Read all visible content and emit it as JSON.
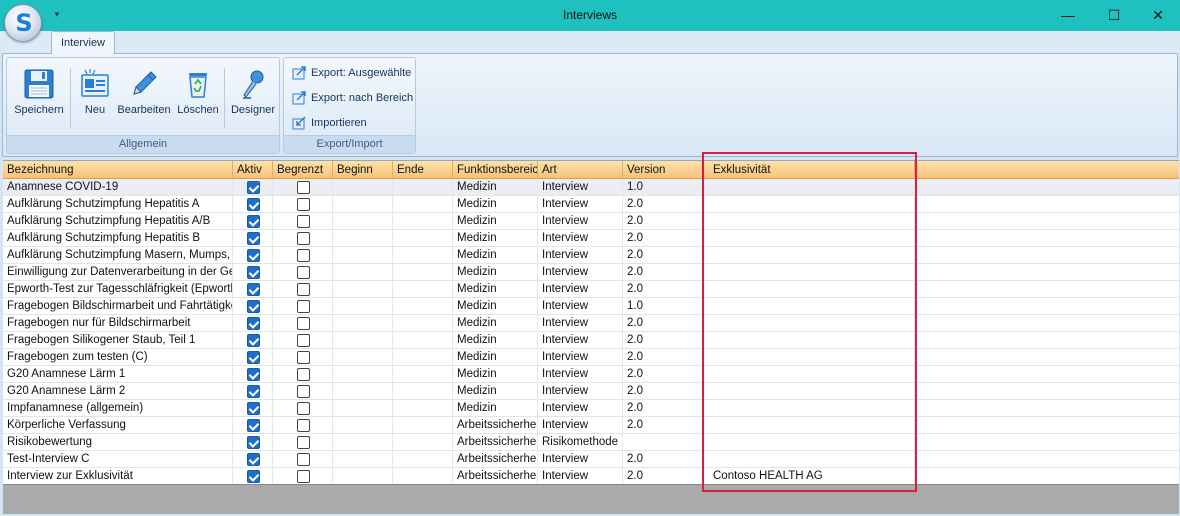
{
  "window": {
    "title": "Interviews",
    "minimize_glyph": "—",
    "maximize_glyph": "☐",
    "close_glyph": "✕",
    "qat_glyph": "▾",
    "app_letter": "S"
  },
  "ribbon": {
    "tab": "Interview",
    "groups": {
      "allgemein": {
        "caption": "Allgemein",
        "buttons": {
          "speichern": "Speichern",
          "neu": "Neu",
          "bearbeiten": "Bearbeiten",
          "loeschen": "Löschen",
          "designer": "Designer"
        }
      },
      "export": {
        "caption": "Export/Import",
        "buttons": {
          "ausgewaehlte": "Export: Ausgewählte",
          "bereich": "Export: nach Bereich",
          "importieren": "Importieren"
        }
      }
    }
  },
  "grid": {
    "columns": [
      "Bezeichnung",
      "Aktiv",
      "Begrenzt",
      "Beginn",
      "Ende",
      "Funktionsbereich",
      "Art",
      "Version",
      "Exklusivität"
    ],
    "rows": [
      {
        "bezeichnung": "Anamnese COVID-19",
        "aktiv": true,
        "begrenzt": false,
        "beginn": "",
        "ende": "",
        "funktionsbereich": "Medizin",
        "art": "Interview",
        "version": "1.0",
        "exklusivitaet": ""
      },
      {
        "bezeichnung": "Aufklärung Schutzimpfung Hepatitis A",
        "aktiv": true,
        "begrenzt": false,
        "beginn": "",
        "ende": "",
        "funktionsbereich": "Medizin",
        "art": "Interview",
        "version": "2.0",
        "exklusivitaet": ""
      },
      {
        "bezeichnung": "Aufklärung Schutzimpfung Hepatitis A/B",
        "aktiv": true,
        "begrenzt": false,
        "beginn": "",
        "ende": "",
        "funktionsbereich": "Medizin",
        "art": "Interview",
        "version": "2.0",
        "exklusivitaet": ""
      },
      {
        "bezeichnung": "Aufklärung Schutzimpfung Hepatitis B",
        "aktiv": true,
        "begrenzt": false,
        "beginn": "",
        "ende": "",
        "funktionsbereich": "Medizin",
        "art": "Interview",
        "version": "2.0",
        "exklusivitaet": ""
      },
      {
        "bezeichnung": "Aufklärung Schutzimpfung Masern, Mumps, Röt",
        "aktiv": true,
        "begrenzt": false,
        "beginn": "",
        "ende": "",
        "funktionsbereich": "Medizin",
        "art": "Interview",
        "version": "2.0",
        "exklusivitaet": ""
      },
      {
        "bezeichnung": "Einwilligung zur Datenverarbeitung in der Gesun",
        "aktiv": true,
        "begrenzt": false,
        "beginn": "",
        "ende": "",
        "funktionsbereich": "Medizin",
        "art": "Interview",
        "version": "2.0",
        "exklusivitaet": ""
      },
      {
        "bezeichnung": "Epworth-Test zur Tagesschläfrigkeit (Epworth S",
        "aktiv": true,
        "begrenzt": false,
        "beginn": "",
        "ende": "",
        "funktionsbereich": "Medizin",
        "art": "Interview",
        "version": "2.0",
        "exklusivitaet": ""
      },
      {
        "bezeichnung": "Fragebogen Bildschirmarbeit und Fahrtätigkeit",
        "aktiv": true,
        "begrenzt": false,
        "beginn": "",
        "ende": "",
        "funktionsbereich": "Medizin",
        "art": "Interview",
        "version": "1.0",
        "exklusivitaet": ""
      },
      {
        "bezeichnung": "Fragebogen nur für Bildschirmarbeit",
        "aktiv": true,
        "begrenzt": false,
        "beginn": "",
        "ende": "",
        "funktionsbereich": "Medizin",
        "art": "Interview",
        "version": "2.0",
        "exklusivitaet": ""
      },
      {
        "bezeichnung": "Fragebogen Silikogener Staub, Teil 1",
        "aktiv": true,
        "begrenzt": false,
        "beginn": "",
        "ende": "",
        "funktionsbereich": "Medizin",
        "art": "Interview",
        "version": "2.0",
        "exklusivitaet": ""
      },
      {
        "bezeichnung": "Fragebogen zum testen (C)",
        "aktiv": true,
        "begrenzt": false,
        "beginn": "",
        "ende": "",
        "funktionsbereich": "Medizin",
        "art": "Interview",
        "version": "2.0",
        "exklusivitaet": ""
      },
      {
        "bezeichnung": "G20 Anamnese Lärm 1",
        "aktiv": true,
        "begrenzt": false,
        "beginn": "",
        "ende": "",
        "funktionsbereich": "Medizin",
        "art": "Interview",
        "version": "2.0",
        "exklusivitaet": ""
      },
      {
        "bezeichnung": "G20 Anamnese Lärm 2",
        "aktiv": true,
        "begrenzt": false,
        "beginn": "",
        "ende": "",
        "funktionsbereich": "Medizin",
        "art": "Interview",
        "version": "2.0",
        "exklusivitaet": ""
      },
      {
        "bezeichnung": "Impfanamnese (allgemein)",
        "aktiv": true,
        "begrenzt": false,
        "beginn": "",
        "ende": "",
        "funktionsbereich": "Medizin",
        "art": "Interview",
        "version": "2.0",
        "exklusivitaet": ""
      },
      {
        "bezeichnung": "Körperliche Verfassung",
        "aktiv": true,
        "begrenzt": false,
        "beginn": "",
        "ende": "",
        "funktionsbereich": "Arbeitssicherheit",
        "art": "Interview",
        "version": "2.0",
        "exklusivitaet": ""
      },
      {
        "bezeichnung": "Risikobewertung",
        "aktiv": true,
        "begrenzt": false,
        "beginn": "",
        "ende": "",
        "funktionsbereich": "Arbeitssicherheit",
        "art": "Risikomethode",
        "version": "",
        "exklusivitaet": ""
      },
      {
        "bezeichnung": "Test-Interview C",
        "aktiv": true,
        "begrenzt": false,
        "beginn": "",
        "ende": "",
        "funktionsbereich": "Arbeitssicherheit",
        "art": "Interview",
        "version": "2.0",
        "exklusivitaet": ""
      },
      {
        "bezeichnung": "Interview zur Exklusivität",
        "aktiv": true,
        "begrenzt": false,
        "beginn": "",
        "ende": "",
        "funktionsbereich": "Arbeitssicherheit",
        "art": "Interview",
        "version": "2.0",
        "exklusivitaet": "Contoso HEALTH AG"
      }
    ]
  },
  "colors": {
    "title_bar": "#1fc0c0",
    "header_orange": "#f7c27a",
    "checkbox_blue": "#1f6fc6",
    "highlight_red": "#d81e45"
  },
  "icons": {
    "speichern": "floppy-disk-icon",
    "neu": "new-document-icon",
    "bearbeiten": "pencil-icon",
    "loeschen": "recycle-bin-icon",
    "designer": "microphone-icon",
    "export": "export-arrow-icon",
    "import": "import-arrow-icon"
  }
}
